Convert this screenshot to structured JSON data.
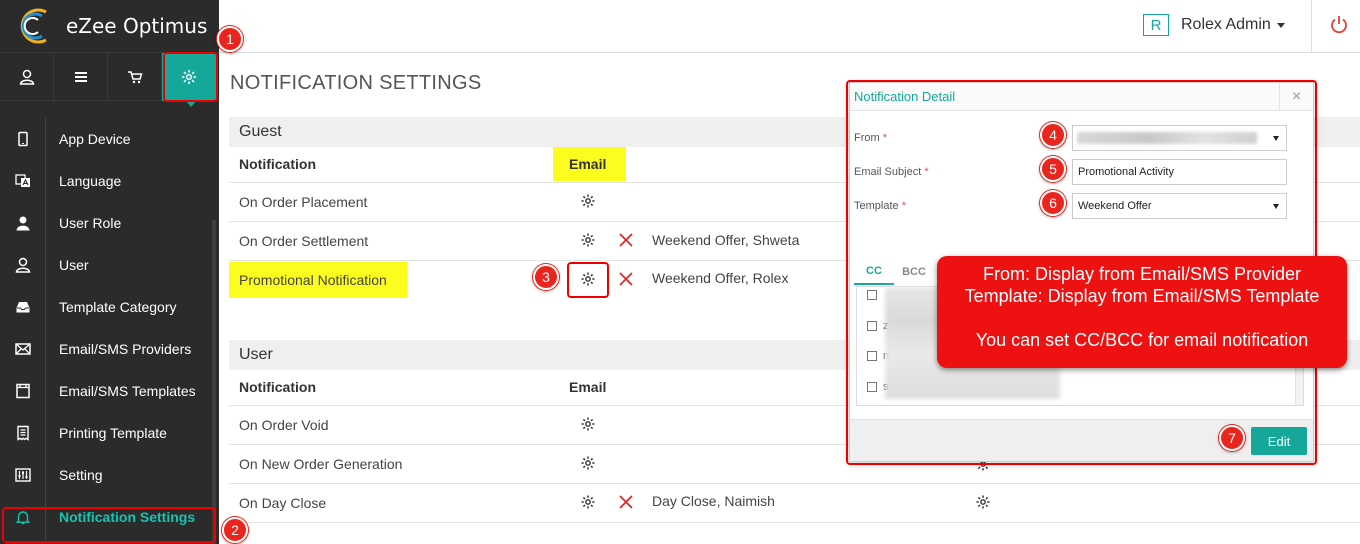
{
  "app": {
    "name": "eZee Optimus"
  },
  "topbar": {
    "user_initial": "R",
    "user_name": "Rolex Admin"
  },
  "sidebar": {
    "tabs": [
      {
        "icon": "user-icon"
      },
      {
        "icon": "menu-icon"
      },
      {
        "icon": "cart-icon"
      },
      {
        "icon": "gear-icon",
        "active": true
      }
    ],
    "items": [
      {
        "label": "App Device",
        "icon": "tablet-icon"
      },
      {
        "label": "Language",
        "icon": "language-icon"
      },
      {
        "label": "User Role",
        "icon": "user-role-icon"
      },
      {
        "label": "User",
        "icon": "user-icon"
      },
      {
        "label": "Template Category",
        "icon": "inbox-icon"
      },
      {
        "label": "Email/SMS Providers",
        "icon": "envelope-icon"
      },
      {
        "label": "Email/SMS Templates",
        "icon": "template-icon"
      },
      {
        "label": "Printing Template",
        "icon": "receipt-icon"
      },
      {
        "label": "Setting",
        "icon": "sliders-icon"
      },
      {
        "label": "Notification Settings",
        "icon": "bell-icon",
        "active": true
      }
    ]
  },
  "page": {
    "title": "NOTIFICATION SETTINGS",
    "guest": {
      "section": "Guest",
      "col_notification": "Notification",
      "col_email": "Email",
      "rows": [
        {
          "label": "On Order Placement",
          "extra": ""
        },
        {
          "label": "On Order Settlement",
          "extra": "Weekend Offer, Shweta"
        },
        {
          "label": "Promotional Notification",
          "extra": "Weekend Offer, Rolex"
        }
      ]
    },
    "user": {
      "section": "User",
      "col_notification": "Notification",
      "col_email": "Email",
      "rows": [
        {
          "label": "On Order Void",
          "extra": ""
        },
        {
          "label": "On New Order Generation",
          "extra": ""
        },
        {
          "label": "On Day Close",
          "extra": "Day Close, Naimish"
        }
      ]
    }
  },
  "modal": {
    "title": "Notification Detail",
    "close": "×",
    "from_label": "From",
    "subject_label": "Email Subject",
    "subject_value": "Promotional Activity",
    "template_label": "Template",
    "template_value": "Weekend Offer",
    "tabs": [
      "CC",
      "BCC"
    ],
    "cc_initials": [
      "z",
      "n",
      "s"
    ],
    "edit_label": "Edit"
  },
  "annotations": {
    "badges": [
      "1",
      "2",
      "3",
      "4",
      "5",
      "6",
      "7"
    ],
    "callout_line1": "From: Display from Email/SMS Provider",
    "callout_line2": "Template: Display from Email/SMS Template",
    "callout_line3": "You can set CC/BCC for email notification"
  },
  "colors": {
    "accent": "#15a89a",
    "sidebar_bg": "#2b2b2b",
    "highlight": "#fcfc1e",
    "annotation_red": "#e8261e"
  }
}
